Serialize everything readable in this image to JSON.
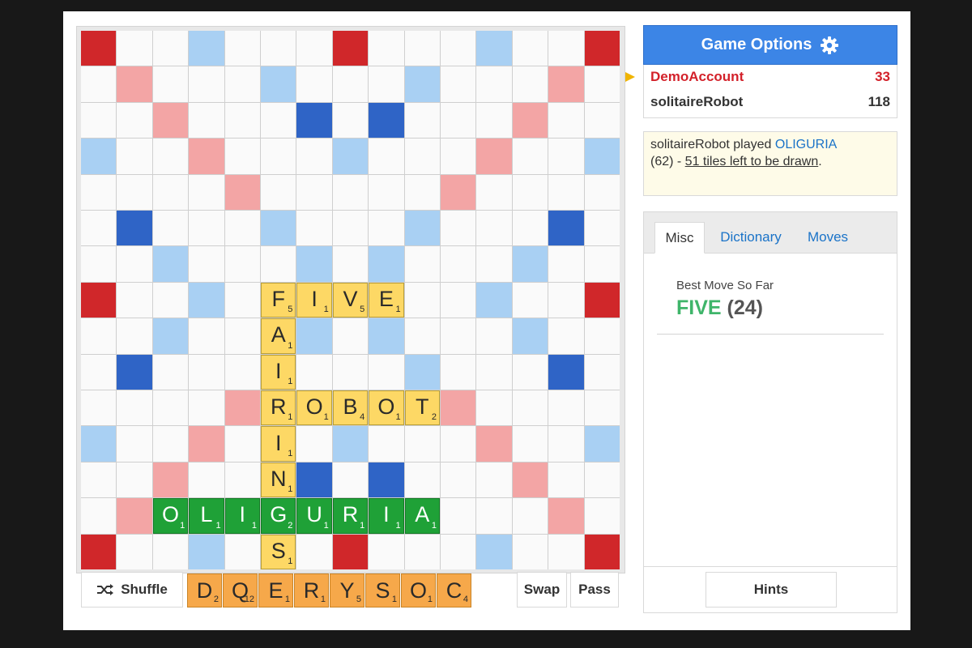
{
  "board": {
    "size": 15,
    "premium_colors": {
      "tw": "#d0272a",
      "dw": "#f3a5a5",
      "tl": "#2f64c6",
      "dl": "#a9d0f3"
    },
    "premium_map": [
      "T..d...T...d..T",
      ".W...l...l...W.",
      "..W...L.L...W..",
      "d..W...d...W..d",
      "....W.....W....",
      ".L...l...l...L.",
      "..d...d.d...d..",
      "T..d...W...d..T",
      "..d...d.d...d..",
      ".L...l...l...L.",
      "....W.....W....",
      "d..W...d...W..d",
      "..W...L.L...W..",
      ".W...l...l...W.",
      "T..d...T...d..T"
    ],
    "tiles": [
      {
        "row": 7,
        "col": 5,
        "letter": "F",
        "points": "5"
      },
      {
        "row": 7,
        "col": 6,
        "letter": "I",
        "points": "1"
      },
      {
        "row": 7,
        "col": 7,
        "letter": "V",
        "points": "5"
      },
      {
        "row": 7,
        "col": 8,
        "letter": "E",
        "points": "1"
      },
      {
        "row": 8,
        "col": 5,
        "letter": "A",
        "points": "1"
      },
      {
        "row": 9,
        "col": 5,
        "letter": "I",
        "points": "1"
      },
      {
        "row": 10,
        "col": 5,
        "letter": "R",
        "points": "1"
      },
      {
        "row": 10,
        "col": 6,
        "letter": "O",
        "points": "1"
      },
      {
        "row": 10,
        "col": 7,
        "letter": "B",
        "points": "4"
      },
      {
        "row": 10,
        "col": 8,
        "letter": "O",
        "points": "1"
      },
      {
        "row": 10,
        "col": 9,
        "letter": "T",
        "points": "2"
      },
      {
        "row": 11,
        "col": 5,
        "letter": "I",
        "points": "1"
      },
      {
        "row": 12,
        "col": 5,
        "letter": "N",
        "points": "1"
      },
      {
        "row": 13,
        "col": 2,
        "letter": "O",
        "points": "1",
        "highlight": true
      },
      {
        "row": 13,
        "col": 3,
        "letter": "L",
        "points": "1",
        "highlight": true
      },
      {
        "row": 13,
        "col": 4,
        "letter": "I",
        "points": "1",
        "highlight": true
      },
      {
        "row": 13,
        "col": 5,
        "letter": "G",
        "points": "2",
        "highlight": true
      },
      {
        "row": 13,
        "col": 6,
        "letter": "U",
        "points": "1",
        "highlight": true
      },
      {
        "row": 13,
        "col": 7,
        "letter": "R",
        "points": "1",
        "highlight": true
      },
      {
        "row": 13,
        "col": 8,
        "letter": "I",
        "points": "1",
        "highlight": true
      },
      {
        "row": 13,
        "col": 9,
        "letter": "A",
        "points": "1",
        "highlight": true
      },
      {
        "row": 14,
        "col": 5,
        "letter": "S",
        "points": "1"
      }
    ]
  },
  "rack": {
    "tiles": [
      {
        "letter": "D",
        "points": "2"
      },
      {
        "letter": "Q",
        "points": "12"
      },
      {
        "letter": "E",
        "points": "1"
      },
      {
        "letter": "R",
        "points": "1"
      },
      {
        "letter": "Y",
        "points": "5"
      },
      {
        "letter": "S",
        "points": "1"
      },
      {
        "letter": "O",
        "points": "1"
      },
      {
        "letter": "C",
        "points": "4"
      }
    ],
    "shuffle_label": "Shuffle",
    "swap_label": "Swap",
    "pass_label": "Pass"
  },
  "header": {
    "game_options_label": "Game Options"
  },
  "players": [
    {
      "name": "DemoAccount",
      "score": "33",
      "active": true
    },
    {
      "name": "solitaireRobot",
      "score": "118",
      "active": false
    }
  ],
  "last_move": {
    "prefix": "solitaireRobot played ",
    "word": "OLIGURIA",
    "score_text": "(62) - ",
    "tiles_left": "51 tiles left to be drawn",
    "suffix": "."
  },
  "tabs": [
    {
      "id": "misc",
      "label": "Misc",
      "active": true
    },
    {
      "id": "dictionary",
      "label": "Dictionary",
      "active": false
    },
    {
      "id": "moves",
      "label": "Moves",
      "active": false
    }
  ],
  "misc": {
    "best_label": "Best Move So Far",
    "best_word": "FIVE",
    "best_score": "(24)"
  },
  "hints_label": "Hints",
  "icons": {
    "shuffle": "shuffle-icon",
    "gear": "gear-icon",
    "turn": "turn-arrow-icon"
  }
}
